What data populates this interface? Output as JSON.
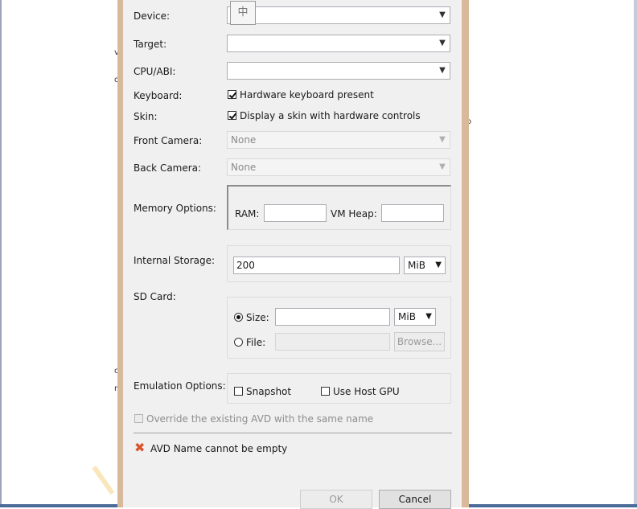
{
  "background": {
    "frag_left": [
      "v",
      "o",
      "c",
      "r"
    ],
    "frag_right": "o"
  },
  "form": {
    "device_label": "Device:",
    "target_label": "Target:",
    "cpu_label": "CPU/ABI:",
    "keyboard_label": "Keyboard:",
    "keyboard_checkbox": "Hardware keyboard present",
    "skin_label": "Skin:",
    "skin_checkbox": "Display a skin with hardware controls",
    "front_camera_label": "Front Camera:",
    "front_camera_value": "None",
    "back_camera_label": "Back Camera:",
    "back_camera_value": "None",
    "memory_label": "Memory Options:",
    "ram_label": "RAM:",
    "vm_heap_label": "VM Heap:",
    "internal_storage_label": "Internal Storage:",
    "internal_storage_value": "200",
    "internal_storage_unit": "MiB",
    "sd_card_label": "SD Card:",
    "size_label": "Size:",
    "size_unit": "MiB",
    "file_label": "File:",
    "browse_button": "Browse...",
    "emulation_label": "Emulation Options:",
    "snapshot_label": "Snapshot",
    "host_gpu_label": "Use Host GPU",
    "override_label": "Override the existing AVD with the same name",
    "error_message": "AVD Name cannot be empty",
    "ok_button": "OK",
    "cancel_button": "Cancel",
    "ime_glyph": "中"
  },
  "colors": {
    "error_icon": "#d9532b",
    "dialog_frame": "#d9b99b",
    "watermark": "#f5cd78"
  },
  "icons": {
    "error": "error-x-icon",
    "dropdown": "chevron-down-icon",
    "ime": "ime-indicator-icon"
  }
}
